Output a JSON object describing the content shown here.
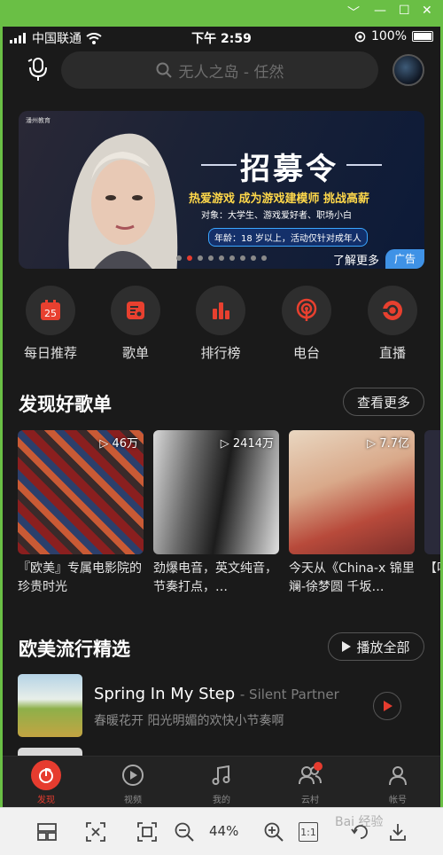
{
  "status_bar": {
    "carrier": "中国联通",
    "time": "下午 2:59",
    "battery": "100%"
  },
  "search": {
    "placeholder": "无人之岛 - 任然"
  },
  "banner": {
    "logo_text": "潘州教育",
    "title": "招募令",
    "subtitle": "热爱游戏 成为游戏建模师 挑战高薪",
    "target": "对象：大学生、游戏爱好者、职场小白",
    "age": "年龄：18 岁以上，活动仅针对成年人",
    "more": "了解更多",
    "ad_label": "广告",
    "dot_count": 9,
    "active_dot": 1
  },
  "categories": [
    {
      "label": "每日推荐",
      "icon": "calendar-icon",
      "day": "25"
    },
    {
      "label": "歌单",
      "icon": "playlist-icon"
    },
    {
      "label": "排行榜",
      "icon": "chart-icon"
    },
    {
      "label": "电台",
      "icon": "radio-icon"
    },
    {
      "label": "直播",
      "icon": "live-icon"
    }
  ],
  "section_playlists": {
    "title": "发现好歌单",
    "more": "查看更多"
  },
  "playlists": [
    {
      "count": "46万",
      "name": "『欧美』专属电影院的珍贵时光"
    },
    {
      "count": "2414万",
      "name": "劲爆电音，英文纯音，节奏打点，…"
    },
    {
      "count": "7.7亿",
      "name": "今天从《China-x 锦里 斓-徐梦圆 千坂…"
    },
    {
      "count": "",
      "name": "【听的"
    }
  ],
  "section_songs": {
    "title": "欧美流行精选",
    "play_all": "播放全部"
  },
  "song": {
    "title": "Spring In My Step",
    "artist": "- Silent Partner",
    "desc": "春暖花开 阳光明媚的欢快小节奏啊"
  },
  "bottom_nav": [
    {
      "label": "发现",
      "icon": "netease-logo-icon",
      "active": true
    },
    {
      "label": "视频",
      "icon": "video-icon"
    },
    {
      "label": "我的",
      "icon": "music-note-icon"
    },
    {
      "label": "云村",
      "icon": "friends-icon",
      "badge": true
    },
    {
      "label": "帐号",
      "icon": "user-icon"
    }
  ],
  "viewer_toolbar": {
    "zoom": "44%",
    "actual_size": "1:1"
  },
  "watermark": "Bai 经验"
}
